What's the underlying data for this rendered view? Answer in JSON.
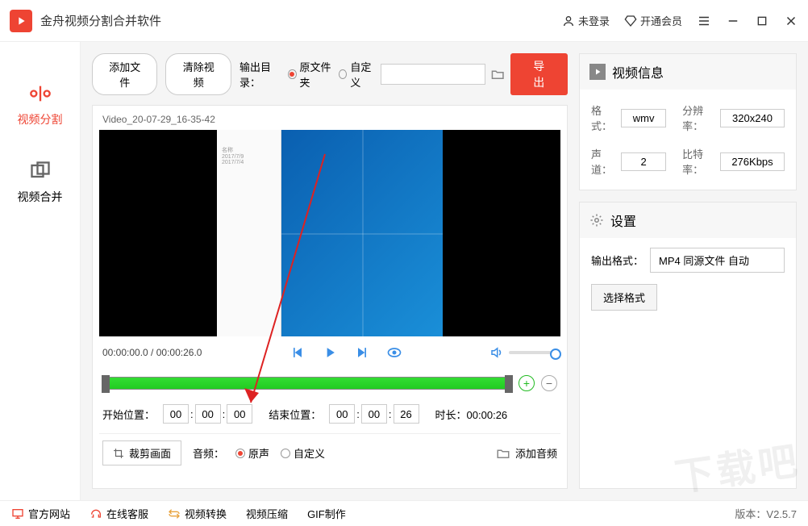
{
  "titlebar": {
    "app_title": "金舟视频分割合并软件",
    "login": "未登录",
    "vip": "开通会员"
  },
  "sidebar": {
    "split": "视频分割",
    "merge": "视频合并"
  },
  "toolbar": {
    "add_file": "添加文件",
    "clear_video": "清除视频",
    "output_dir_label": "输出目录：",
    "opt_original": "原文件夹",
    "opt_custom": "自定义",
    "export": "导出"
  },
  "video": {
    "name": "Video_20-07-29_16-35-42",
    "time_current": "00:00:00.0",
    "time_total": "00:00:26.0"
  },
  "position": {
    "start_label": "开始位置：",
    "start_h": "00",
    "start_m": "00",
    "start_s": "00",
    "end_label": "结束位置：",
    "end_h": "00",
    "end_m": "00",
    "end_s": "26",
    "dur_label": "时长：",
    "dur_val": "00:00:26"
  },
  "bottom": {
    "crop": "裁剪画面",
    "audio_label": "音频：",
    "audio_original": "原声",
    "audio_custom": "自定义",
    "add_audio": "添加音频"
  },
  "info_panel": {
    "title": "视频信息",
    "format_label": "格式：",
    "format_val": "wmv",
    "res_label": "分辨率：",
    "res_val": "320x240",
    "channel_label": "声道：",
    "channel_val": "2",
    "bitrate_label": "比特率：",
    "bitrate_val": "276Kbps"
  },
  "settings_panel": {
    "title": "设置",
    "out_fmt_label": "输出格式：",
    "out_fmt_val": "MP4 同源文件 自动",
    "select_fmt": "选择格式"
  },
  "footer": {
    "website": "官方网站",
    "cs": "在线客服",
    "convert": "视频转换",
    "compress": "视频压缩",
    "gif": "GIF制作",
    "version": "版本：V2.5.7"
  }
}
